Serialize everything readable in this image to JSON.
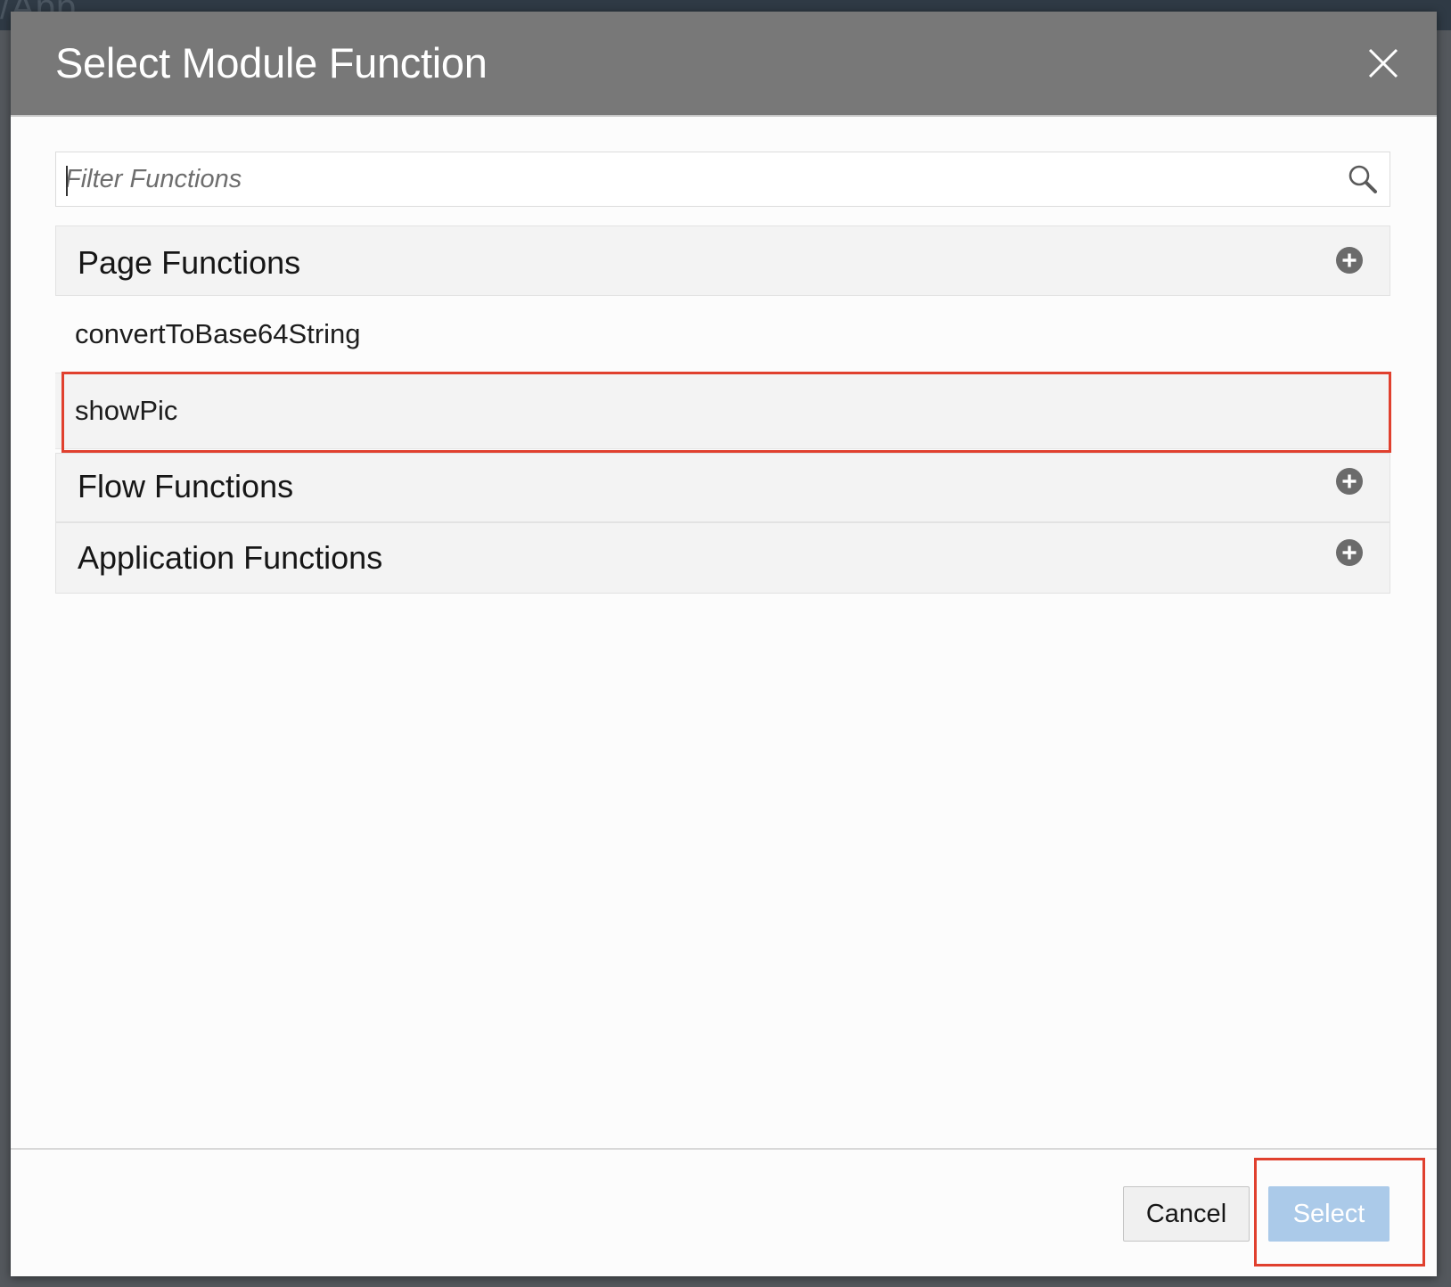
{
  "backdrop": {
    "app_title_fragment": "/App"
  },
  "dialog": {
    "title": "Select Module Function",
    "filter": {
      "placeholder": "Filter Functions",
      "value": ""
    },
    "groups": [
      {
        "label": "Page Functions",
        "expanded": true,
        "items": [
          {
            "label": "convertToBase64String",
            "selected": false
          },
          {
            "label": "showPic",
            "selected": true
          }
        ]
      },
      {
        "label": "Flow Functions",
        "expanded": false,
        "items": []
      },
      {
        "label": "Application Functions",
        "expanded": false,
        "items": []
      }
    ],
    "footer": {
      "cancel_label": "Cancel",
      "select_label": "Select"
    }
  },
  "colors": {
    "header_bg": "#787878",
    "highlight": "#e0402e",
    "select_button": "#abcae9",
    "group_bg": "#f3f3f3"
  },
  "icons": {
    "close": "close-icon",
    "search": "search-icon",
    "expand": "plus-circle-icon"
  }
}
